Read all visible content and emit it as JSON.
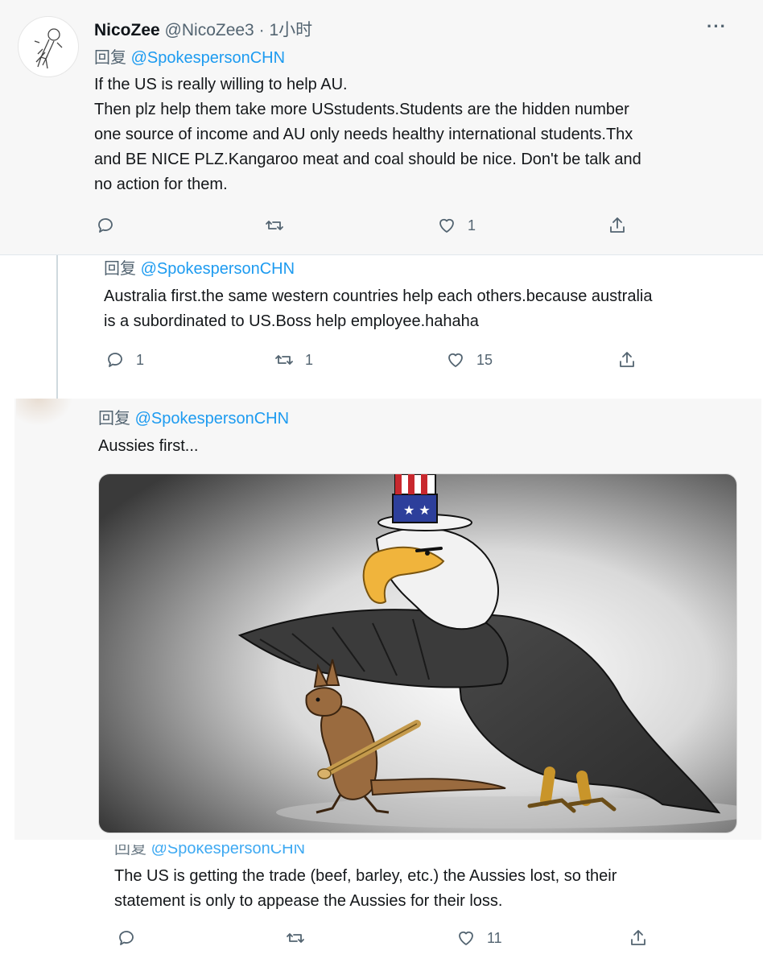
{
  "tweet1": {
    "name": "NicoZee",
    "handle": "@NicoZee3",
    "dot": "·",
    "time": "1小时",
    "more": "···",
    "reply_word": "回复",
    "mention": "@SpokespersonCHN",
    "lines": [
      "If the US is really willing to help AU.",
      "Then plz help them take more USstudents.Students are the hidden number",
      "one source of income and AU only needs healthy international students.Thx",
      "and BE NICE PLZ.Kangaroo meat and coal should be nice. Don't be talk and",
      "no action for them."
    ],
    "stats": {
      "reply": "",
      "retweet": "",
      "like": "1"
    }
  },
  "tweet2": {
    "reply_word": "回复",
    "mention": "@SpokespersonCHN",
    "lines": [
      "Australia first.the same western countries help each others.because australia",
      "is a subordinated to US.Boss help employee.hahaha"
    ],
    "stats": {
      "reply": "1",
      "retweet": "1",
      "like": "15"
    }
  },
  "tweet3": {
    "reply_word": "回复",
    "mention": "@SpokespersonCHN",
    "text": "Aussies first...",
    "image_alt": "cartoon-eagle-kangaroo"
  },
  "tweet4": {
    "reply_word": "回复",
    "mention": "@SpokespersonCHN",
    "lines": [
      "The US is getting the trade (beef, barley, etc.) the Aussies lost, so their",
      "statement is only to appease the Aussies for their loss."
    ],
    "stats": {
      "reply": "",
      "retweet": "",
      "like": "11"
    }
  },
  "colors": {
    "accent": "#1d9bf0",
    "muted": "#536471",
    "panel": "#f7f7f7"
  }
}
